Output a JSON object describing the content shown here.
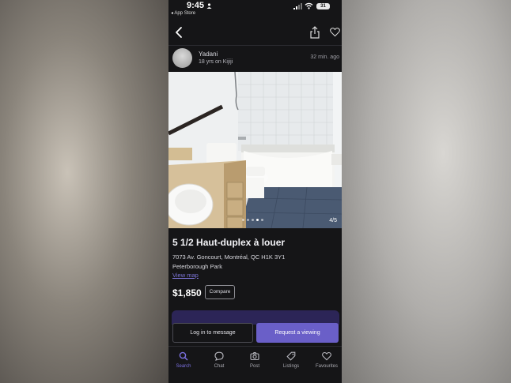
{
  "status_bar": {
    "time": "9:45",
    "back_app": "◂ App Store",
    "battery": "31"
  },
  "seller": {
    "name": "Yadani",
    "since": "18 yrs on Kijiji",
    "posted": "32 min. ago"
  },
  "gallery": {
    "counter": "4/5",
    "current_index": 4,
    "total": 5
  },
  "listing": {
    "title": "5 1/2 Haut-duplex à louer",
    "address": "7073 Av. Goncourt, Montréal, QC H1K 3Y1",
    "area": "Peterborough Park",
    "view_map": "View map",
    "price": "$1,850",
    "compare": "Compare"
  },
  "actions": {
    "login": "Log in to message",
    "request": "Request a viewing"
  },
  "tabs": [
    {
      "label": "Search",
      "icon": "search-icon",
      "active": true
    },
    {
      "label": "Chat",
      "icon": "chat-icon",
      "active": false
    },
    {
      "label": "Post",
      "icon": "camera-icon",
      "active": false
    },
    {
      "label": "Listings",
      "icon": "tag-icon",
      "active": false
    },
    {
      "label": "Favourites",
      "icon": "heart-icon",
      "active": false
    }
  ],
  "colors": {
    "background": "#151517",
    "accent": "#6a5fc8",
    "link": "#7c74d6"
  }
}
